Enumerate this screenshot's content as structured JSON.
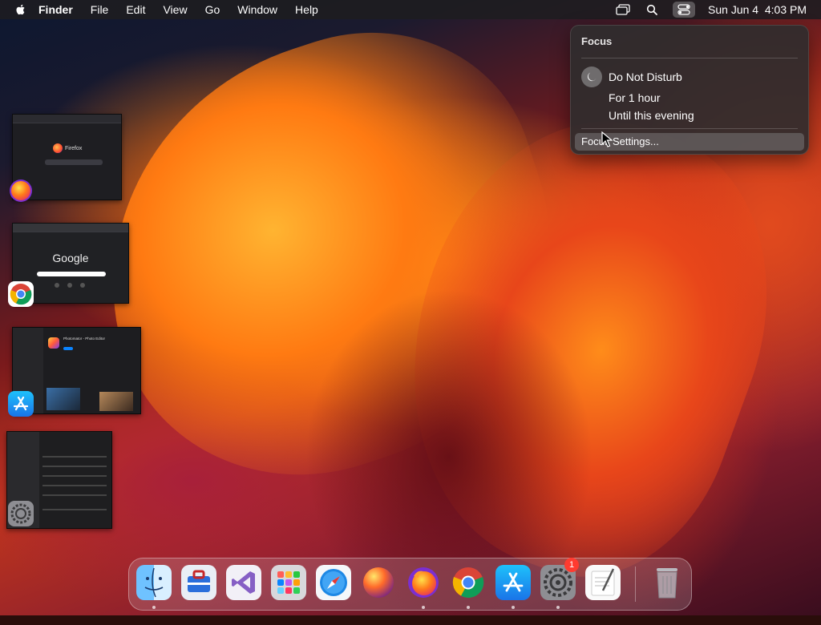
{
  "menubar": {
    "app_name": "Finder",
    "items": [
      "File",
      "Edit",
      "View",
      "Go",
      "Window",
      "Help"
    ],
    "clock": "Sun Jun 4  4:03 PM",
    "status_icons": [
      "screen-mirroring-icon",
      "spotlight-search-icon",
      "control-center-icon"
    ]
  },
  "focus_panel": {
    "title": "Focus",
    "dnd_label": "Do Not Disturb",
    "options": [
      "For 1 hour",
      "Until this evening"
    ],
    "settings_label": "Focus Settings..."
  },
  "thumbnails": {
    "firefox": {
      "brand": "Firefox"
    },
    "chrome": {
      "brand": "Google"
    },
    "appstore": {
      "heading": "Photomator - Photo Editor"
    }
  },
  "dock": {
    "items": [
      {
        "name": "finder",
        "icon": "finder-icon",
        "running": true
      },
      {
        "name": "toolbox",
        "icon": "toolbox-icon",
        "running": false
      },
      {
        "name": "visual-studio",
        "icon": "visual-studio-icon",
        "running": false
      },
      {
        "name": "launchpad",
        "icon": "launchpad-icon",
        "running": false
      },
      {
        "name": "safari",
        "icon": "safari-icon",
        "running": false
      },
      {
        "name": "firefox-nightly",
        "icon": "firefox-nightly-icon",
        "running": false
      },
      {
        "name": "firefox",
        "icon": "firefox-icon",
        "running": true
      },
      {
        "name": "chrome",
        "icon": "chrome-icon",
        "running": true
      },
      {
        "name": "app-store",
        "icon": "app-store-icon",
        "running": true
      },
      {
        "name": "system-settings",
        "icon": "system-settings-icon",
        "running": true,
        "badge": "1"
      },
      {
        "name": "textedit",
        "icon": "textedit-icon",
        "running": false
      },
      {
        "name": "trash",
        "icon": "trash-icon",
        "running": false
      }
    ]
  },
  "colors": {
    "menubar_bg": "#1e1c20",
    "panel_bg": "#302c2e",
    "badge_red": "#ff3b30"
  }
}
